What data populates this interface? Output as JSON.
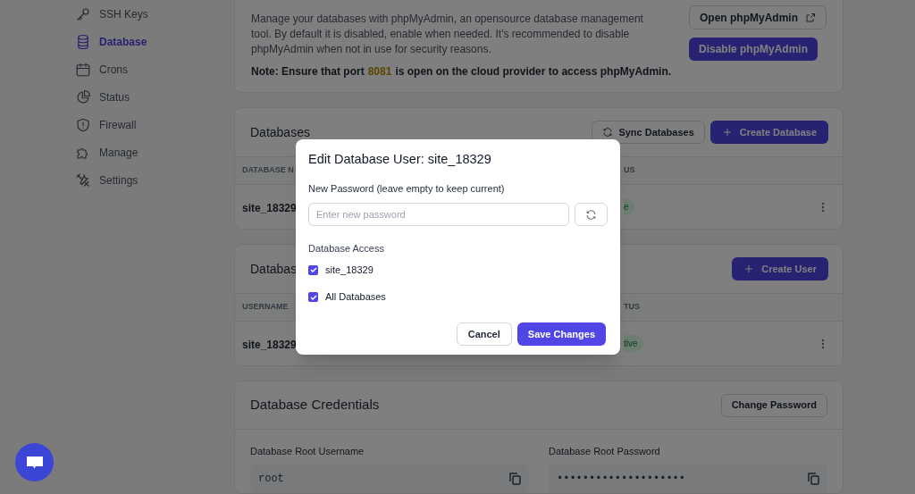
{
  "sidebar": {
    "items": [
      {
        "label": "SSH Keys",
        "selected": false
      },
      {
        "label": "Database",
        "selected": true
      },
      {
        "label": "Crons",
        "selected": false
      },
      {
        "label": "Status",
        "selected": false
      },
      {
        "label": "Firewall",
        "selected": false
      },
      {
        "label": "Manage",
        "selected": false
      },
      {
        "label": "Settings",
        "selected": false
      }
    ]
  },
  "phpmyadmin": {
    "description": "Manage your databases with phpMyAdmin, an opensource database management tool. By default it is disabled, enable when needed. It's recommended to disable phpMyAdmin when not in use for security reasons.",
    "note": {
      "before": "Note: Ensure that port",
      "port": "8081",
      "after": "is open on the cloud provider to access phpMyAdmin."
    },
    "open_button": "Open phpMyAdmin",
    "disable_button": "Disable phpMyAdmin"
  },
  "databases": {
    "title": "Databases",
    "sync_button": "Sync Databases",
    "create_button": "Create Database",
    "columns": [
      "DATABASE N",
      "US"
    ],
    "rows": [
      {
        "name": "site_18329",
        "status": "e"
      }
    ]
  },
  "users": {
    "title": "Databas",
    "create_button": "Create User",
    "columns": [
      "USERNAME",
      "TUS"
    ],
    "rows": [
      {
        "name": "site_18329",
        "status": "tive"
      }
    ]
  },
  "credentials": {
    "title": "Database Credentials",
    "change_button": "Change Password",
    "fields": [
      {
        "label": "Database Root Username",
        "value": "root"
      },
      {
        "label": "Database Root Password",
        "value": "••••••••••••••••••••"
      }
    ]
  },
  "modal": {
    "title": "Edit Database User: site_18329",
    "password_label": "New Password (leave empty to keep current)",
    "placeholder": "Enter new password",
    "access_label": "Database Access",
    "options": [
      {
        "label": "site_18329",
        "checked": true
      },
      {
        "label": "All Databases",
        "checked": true
      }
    ],
    "cancel": "Cancel",
    "save": "Save Changes"
  }
}
